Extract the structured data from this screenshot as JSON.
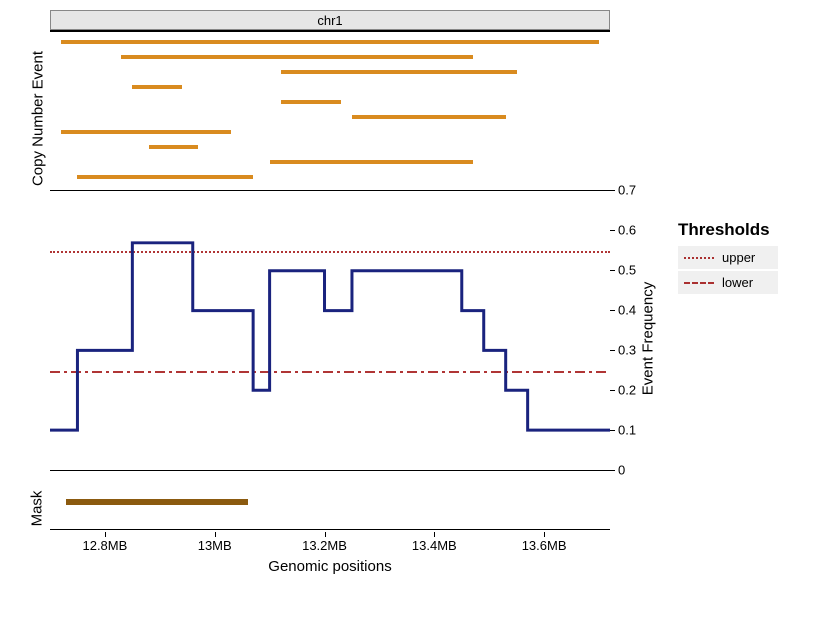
{
  "strip_label": "chr1",
  "axis": {
    "xlabel": "Genomic positions",
    "ylabel_right": "Event Frequency",
    "ylabel_left_top": "Copy Number Event",
    "ylabel_left_bot": "Mask",
    "xticks": [
      "12.8MB",
      "13MB",
      "13.2MB",
      "13.4MB",
      "13.6MB"
    ],
    "yticks": [
      "0",
      "0.1",
      "0.2",
      "0.3",
      "0.4",
      "0.5",
      "0.6",
      "0.7"
    ]
  },
  "legend": {
    "title": "Thresholds",
    "items": [
      {
        "label": "upper",
        "style": "dotted"
      },
      {
        "label": "lower",
        "style": "dashdot"
      }
    ]
  },
  "chart_data": {
    "type": "area",
    "x_range_mb": [
      12.7,
      13.72
    ],
    "panels": [
      {
        "name": "Copy Number Event",
        "segments_mb": [
          {
            "start": 12.72,
            "end": 13.7,
            "row": 0
          },
          {
            "start": 12.83,
            "end": 13.47,
            "row": 1
          },
          {
            "start": 13.12,
            "end": 13.55,
            "row": 2
          },
          {
            "start": 12.85,
            "end": 12.94,
            "row": 3
          },
          {
            "start": 13.12,
            "end": 13.23,
            "row": 4
          },
          {
            "start": 13.25,
            "end": 13.53,
            "row": 5
          },
          {
            "start": 12.72,
            "end": 13.03,
            "row": 6
          },
          {
            "start": 12.88,
            "end": 12.97,
            "row": 7
          },
          {
            "start": 13.1,
            "end": 13.47,
            "row": 8
          },
          {
            "start": 12.75,
            "end": 13.07,
            "row": 9
          }
        ]
      },
      {
        "name": "Event Frequency",
        "y_range": [
          0,
          0.7
        ],
        "thresholds": {
          "upper": 0.55,
          "lower": 0.25
        },
        "step_points": [
          {
            "x": 12.7,
            "y": 0.1
          },
          {
            "x": 12.75,
            "y": 0.3
          },
          {
            "x": 12.85,
            "y": 0.57
          },
          {
            "x": 12.96,
            "y": 0.4
          },
          {
            "x": 13.07,
            "y": 0.2
          },
          {
            "x": 13.1,
            "y": 0.5
          },
          {
            "x": 13.2,
            "y": 0.4
          },
          {
            "x": 13.25,
            "y": 0.5
          },
          {
            "x": 13.45,
            "y": 0.4
          },
          {
            "x": 13.49,
            "y": 0.3
          },
          {
            "x": 13.53,
            "y": 0.2
          },
          {
            "x": 13.57,
            "y": 0.1
          },
          {
            "x": 13.72,
            "y": 0.1
          }
        ]
      },
      {
        "name": "Mask",
        "segments_mb": [
          {
            "start": 12.73,
            "end": 13.06,
            "row": 0
          }
        ]
      }
    ]
  }
}
